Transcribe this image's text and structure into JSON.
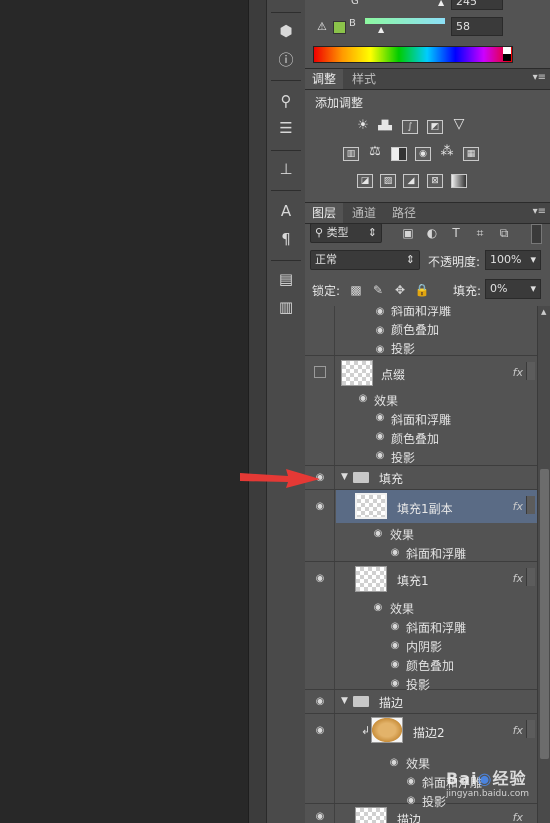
{
  "color_panel": {
    "g_label": "G",
    "g_value": "245",
    "b_label": "B",
    "b_value": "58",
    "warning_icon": "gamut-warning-icon",
    "swatch_color": "#8bc34a"
  },
  "adjustments_panel": {
    "tabs": [
      "调整",
      "样式"
    ],
    "title": "添加调整"
  },
  "layers_panel": {
    "tabs": [
      "图层",
      "通道",
      "路径"
    ],
    "filter_kind": "类型",
    "blend_mode": "正常",
    "opacity_label": "不透明度:",
    "opacity_value": "100%",
    "lock_label": "锁定:",
    "fill_label": "填充:",
    "fill_value": "0%",
    "fx_label": "fx",
    "partial_top": {
      "effects": [
        "斜面和浮雕",
        "颜色叠加",
        "投影"
      ]
    },
    "layer_dianzhui": {
      "name": "点缀",
      "effects_label": "效果",
      "effects": [
        "斜面和浮雕",
        "颜色叠加",
        "投影"
      ]
    },
    "group_fill": {
      "name": "填充"
    },
    "layer_fill_copy": {
      "name": "填充1副本",
      "effects_label": "效果",
      "effects": [
        "斜面和浮雕"
      ]
    },
    "layer_fill1": {
      "name": "填充1",
      "effects_label": "效果",
      "effects": [
        "斜面和浮雕",
        "内阴影",
        "颜色叠加",
        "投影"
      ]
    },
    "group_stroke": {
      "name": "描边"
    },
    "layer_stroke2": {
      "name": "描边2",
      "effects_label": "效果",
      "effects": [
        "斜面和浮雕",
        "投影"
      ]
    },
    "layer_stroke_bottom": {
      "name": "描边"
    }
  },
  "watermark": "jingyan.baidu.com"
}
